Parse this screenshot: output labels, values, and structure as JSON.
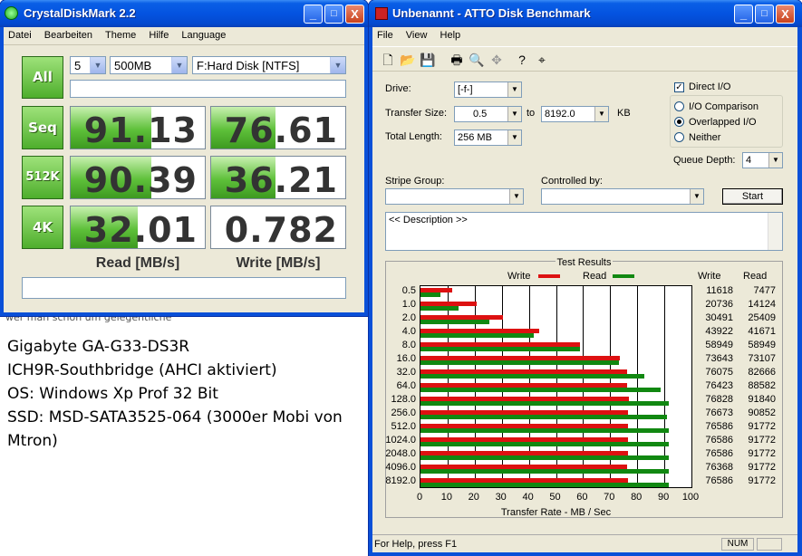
{
  "background_text": {
    "partial_line": "wer man schon um gelegentliche",
    "notes": [
      "Gigabyte GA-G33-DS3R",
      "ICH9R-Southbridge (AHCI aktiviert)",
      "OS: Windows Xp Prof 32 Bit",
      "SSD: MSD-SATA3525-064 (3000er Mobi von",
      "Mtron)"
    ]
  },
  "cdm": {
    "title": "CrystalDiskMark 2.2",
    "title_buttons": {
      "minimize": "_",
      "maximize": "□",
      "close": "X"
    },
    "menu": [
      "Datei",
      "Bearbeiten",
      "Theme",
      "Hilfe",
      "Language"
    ],
    "all_button": "All",
    "runs": "5",
    "size": "500MB",
    "drive": "F:Hard Disk [NTFS]",
    "rows": [
      {
        "label": "Seq",
        "read": "91.13",
        "write": "76.61",
        "read_fill": 0.6,
        "write_fill": 0.48
      },
      {
        "label": "512K",
        "read": "90.39",
        "write": "36.21",
        "read_fill": 0.6,
        "write_fill": 0.48
      },
      {
        "label": "4K",
        "read": "32.01",
        "write": "0.782",
        "read_fill": 0.5,
        "write_fill": 0
      }
    ],
    "read_header": "Read [MB/s]",
    "write_header": "Write [MB/s]",
    "accent": "#4eae2c"
  },
  "atto": {
    "title": "Unbenannt - ATTO Disk Benchmark",
    "title_buttons": {
      "minimize": "_",
      "maximize": "□",
      "close": "X"
    },
    "menu": [
      "File",
      "View",
      "Help"
    ],
    "toolbar_icons": [
      "new-icon",
      "open-icon",
      "save-icon",
      "print-icon",
      "print-preview-icon",
      "move-icon",
      "help-icon",
      "context-help-icon"
    ],
    "drive_label": "Drive:",
    "drive_value": "[-f-]",
    "transfer_label": "Transfer Size:",
    "transfer_from": "0.5",
    "to_label": "to",
    "transfer_to": "8192.0",
    "kb_label": "KB",
    "total_label": "Total Length:",
    "total_value": "256 MB",
    "direct_io": "Direct I/O",
    "io_comparison": "I/O Comparison",
    "overlapped_io": "Overlapped I/O",
    "neither": "Neither",
    "queue_label": "Queue Depth:",
    "queue_value": "4",
    "stripe_label": "Stripe Group:",
    "controlled_label": "Controlled by:",
    "start_button": "Start",
    "description": "<< Description >>",
    "results_title": "Test Results",
    "legend_write": "Write",
    "legend_read": "Read",
    "col_write": "Write",
    "col_read": "Read",
    "x_axis_label": "Transfer Rate - MB / Sec",
    "status_text": "For Help, press F1",
    "status_num": "NUM",
    "write_color": "#dd1111",
    "read_color": "#118811"
  },
  "chart_data": {
    "type": "bar",
    "orientation": "horizontal",
    "title": "Test Results",
    "xlabel": "Transfer Rate - MB / Sec",
    "xlim": [
      0,
      100
    ],
    "xticks": [
      "0",
      "10",
      "20",
      "30",
      "40",
      "50",
      "60",
      "70",
      "80",
      "90",
      "100"
    ],
    "categories": [
      "0.5",
      "1.0",
      "2.0",
      "4.0",
      "8.0",
      "16.0",
      "32.0",
      "64.0",
      "128.0",
      "256.0",
      "512.0",
      "1024.0",
      "2048.0",
      "4096.0",
      "8192.0"
    ],
    "series": [
      {
        "name": "Write",
        "color": "#dd1111",
        "values": [
          11.6,
          20.7,
          30.5,
          43.9,
          58.9,
          73.6,
          76.1,
          76.4,
          76.8,
          76.7,
          76.6,
          76.6,
          76.6,
          76.4,
          76.6
        ],
        "labels": [
          "11618",
          "20736",
          "30491",
          "43922",
          "58949",
          "73643",
          "76075",
          "76423",
          "76828",
          "76673",
          "76586",
          "76586",
          "76586",
          "76368",
          "76586"
        ]
      },
      {
        "name": "Read",
        "color": "#118811",
        "values": [
          7.5,
          14.1,
          25.4,
          41.7,
          58.9,
          73.1,
          82.7,
          88.6,
          91.8,
          90.9,
          91.8,
          91.8,
          91.8,
          91.8,
          91.8
        ],
        "labels": [
          "7477",
          "14124",
          "25409",
          "41671",
          "58949",
          "73107",
          "82666",
          "88582",
          "91840",
          "90852",
          "91772",
          "91772",
          "91772",
          "91772",
          "91772"
        ]
      }
    ]
  }
}
